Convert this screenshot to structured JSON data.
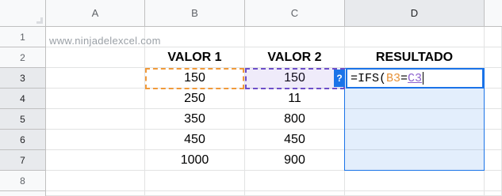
{
  "columns": [
    "A",
    "B",
    "C",
    "D"
  ],
  "rows": [
    "1",
    "2",
    "3",
    "4",
    "5",
    "6",
    "7",
    "8"
  ],
  "watermark": "www.ninjadelexcel.com",
  "headers": {
    "b": "VALOR 1",
    "c": "VALOR 2",
    "d": "RESULTADO"
  },
  "data": [
    {
      "b": "150",
      "c": "150"
    },
    {
      "b": "250",
      "c": "11"
    },
    {
      "b": "350",
      "c": "800"
    },
    {
      "b": "450",
      "c": "450"
    },
    {
      "b": "1000",
      "c": "900"
    }
  ],
  "editor": {
    "prefix": "=IFS(",
    "ref1": "B3",
    "op": "=",
    "ref2": "C3"
  },
  "help_icon": "?",
  "colors": {
    "ref1": "#e69138",
    "ref2": "#8e63ce",
    "selection": "#1a73e8"
  }
}
